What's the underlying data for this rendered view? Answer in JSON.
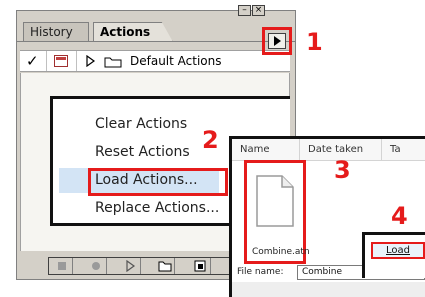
{
  "palette": {
    "tabs": [
      {
        "label": "History",
        "active": false
      },
      {
        "label": "Actions",
        "active": true
      }
    ],
    "title_buttons": [
      "minimize-icon",
      "close-icon"
    ],
    "set_row": {
      "checked_glyph": "✓",
      "expander_icon": "triangle-right-icon",
      "folder_icon": "folder-icon",
      "name": "Default Actions"
    },
    "menu_button_icon": "triangle-right-icon",
    "bottom_buttons": [
      "stop-icon",
      "record-icon",
      "play-icon",
      "new-set-icon",
      "new-action-icon"
    ]
  },
  "flyout_menu": {
    "items": [
      {
        "label": "Clear Actions",
        "highlighted": false
      },
      {
        "label": "Reset Actions",
        "highlighted": false
      },
      {
        "label": "Load Actions...",
        "highlighted": true
      },
      {
        "label": "Replace Actions...",
        "highlighted": false
      }
    ]
  },
  "file_dialog": {
    "columns": [
      "Name",
      "Date taken",
      "Ta"
    ],
    "file": {
      "name": "Combine.atn",
      "icon": "file-icon"
    },
    "file_name_label": "File name:",
    "file_name_value": "Combine",
    "load_button": "Load"
  },
  "steps": [
    "1",
    "2",
    "3",
    "4"
  ],
  "colors": {
    "highlight_red": "#e51b1b",
    "panel_gray": "#d4d0c8",
    "menu_highlight": "#d3e4f5"
  }
}
